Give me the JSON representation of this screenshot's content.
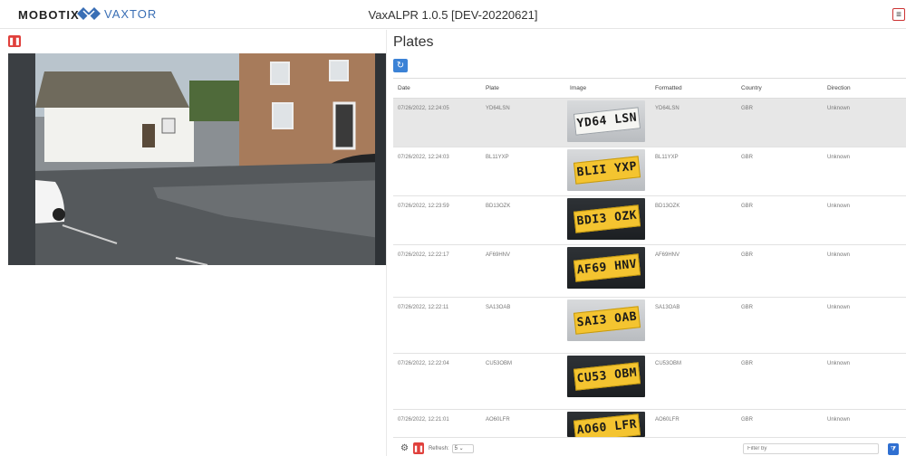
{
  "header": {
    "brand_left": "MOBOTIX",
    "brand_right": "VAXTOR",
    "title": "VaxALPR 1.0.5 [DEV-20220621]",
    "menu_icon": "hamburger-icon"
  },
  "left": {
    "pause_icon": "pause-icon"
  },
  "plates": {
    "title": "Plates",
    "refresh_icon": "refresh-icon",
    "columns": [
      "Date",
      "Plate",
      "Image",
      "Formatted",
      "Country",
      "Direction"
    ],
    "rows": [
      {
        "date": "07/26/2022, 12:24:05",
        "plate": "YD64LSN",
        "image_text": "YD64 LSN",
        "formatted": "YD64LSN",
        "country": "GBR",
        "direction": "Unknown"
      },
      {
        "date": "07/26/2022, 12:24:03",
        "plate": "BL11YXP",
        "image_text": "BLII YXP",
        "formatted": "BL11YXP",
        "country": "GBR",
        "direction": "Unknown"
      },
      {
        "date": "07/26/2022, 12:23:59",
        "plate": "BD13OZK",
        "image_text": "BDI3 OZK",
        "formatted": "BD13OZK",
        "country": "GBR",
        "direction": "Unknown"
      },
      {
        "date": "07/26/2022, 12:22:17",
        "plate": "AF69HNV",
        "image_text": "AF69 HNV",
        "formatted": "AF69HNV",
        "country": "GBR",
        "direction": "Unknown"
      },
      {
        "date": "07/26/2022, 12:22:11",
        "plate": "SA13OAB",
        "image_text": "SAI3 OAB",
        "formatted": "SA13OAB",
        "country": "GBR",
        "direction": "Unknown"
      },
      {
        "date": "07/26/2022, 12:22:04",
        "plate": "CU53OBM",
        "image_text": "CU53 OBM",
        "formatted": "CU53OBM",
        "country": "GBR",
        "direction": "Unknown"
      },
      {
        "date": "07/26/2022, 12:21:01",
        "plate": "AO60LFR",
        "image_text": "AO60 LFR",
        "formatted": "AO60LFR",
        "country": "GBR",
        "direction": "Unknown"
      }
    ]
  },
  "footer": {
    "gear_icon": "gear-icon",
    "pause_icon": "pause-icon",
    "refresh_label": "Refresh:",
    "refresh_value": "5",
    "filter_placeholder": "Filter by",
    "filter_icon": "filter-icon"
  },
  "colors": {
    "accent_blue": "#3b82d6",
    "danger_red": "#e0403c",
    "plate_yellow": "#f4c430",
    "selected_row": "#e7e7e7"
  }
}
